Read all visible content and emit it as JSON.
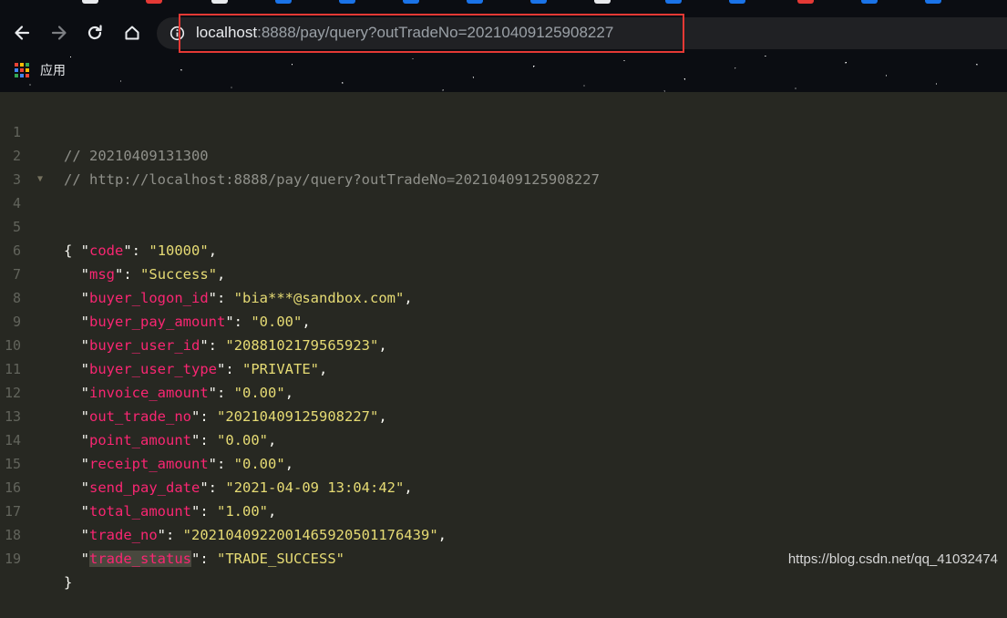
{
  "browser": {
    "address_bar": {
      "host": "localhost",
      "rest": ":8888/pay/query?outTradeNo=20210409125908227"
    },
    "bookmarks": [
      {
        "label": "应用",
        "icon": "apps-grid-icon"
      }
    ],
    "nav_icons": [
      "back-arrow-icon",
      "forward-arrow-icon",
      "reload-icon",
      "home-icon",
      "info-icon"
    ]
  },
  "viewer": {
    "comments": [
      "// 20210409131300",
      "// http://localhost:8888/pay/query?outTradeNo=20210409125908227"
    ],
    "open_brace": "{",
    "close_brace": "}",
    "json_fields": [
      {
        "key": "code",
        "value": "10000"
      },
      {
        "key": "msg",
        "value": "Success"
      },
      {
        "key": "buyer_logon_id",
        "value": "bia***@sandbox.com"
      },
      {
        "key": "buyer_pay_amount",
        "value": "0.00"
      },
      {
        "key": "buyer_user_id",
        "value": "2088102179565923"
      },
      {
        "key": "buyer_user_type",
        "value": "PRIVATE"
      },
      {
        "key": "invoice_amount",
        "value": "0.00"
      },
      {
        "key": "out_trade_no",
        "value": "20210409125908227"
      },
      {
        "key": "point_amount",
        "value": "0.00"
      },
      {
        "key": "receipt_amount",
        "value": "0.00"
      },
      {
        "key": "send_pay_date",
        "value": "2021-04-09 13:04:42"
      },
      {
        "key": "total_amount",
        "value": "1.00"
      },
      {
        "key": "trade_no",
        "value": "2021040922001465920501176439"
      },
      {
        "key": "trade_status",
        "value": "TRADE_SUCCESS"
      }
    ],
    "line_numbers": [
      "1",
      "2",
      "3",
      "4",
      "5",
      "6",
      "7",
      "8",
      "9",
      "10",
      "11",
      "12",
      "13",
      "14",
      "15",
      "16",
      "17",
      "18",
      "19"
    ]
  },
  "watermark": "https://blog.csdn.net/qq_41032474",
  "colors": {
    "background": "#272822",
    "key": "#f92672",
    "string": "#e6db74",
    "comment": "#8f908a",
    "highlight_box": "#e53935"
  }
}
